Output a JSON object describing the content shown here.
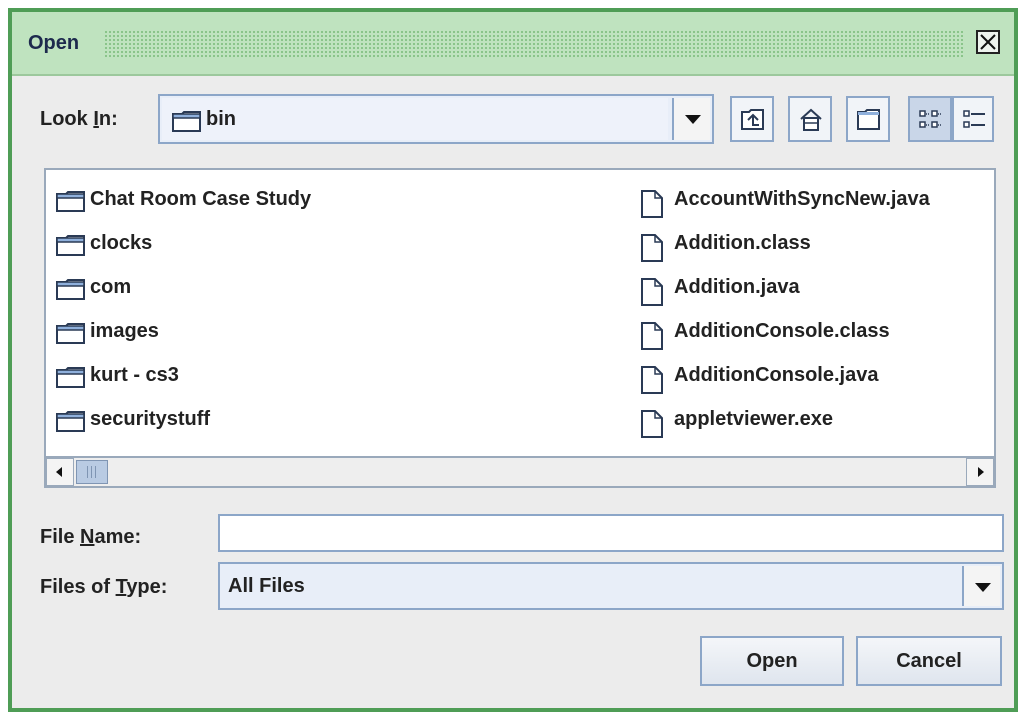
{
  "window": {
    "title": "Open"
  },
  "look_in": {
    "label_pre": "Look ",
    "label_mnemonic": "I",
    "label_post": "n:",
    "value": "bin",
    "folder_icon": "folder-icon"
  },
  "toolbar": {
    "buttons": [
      {
        "name": "up-one-level",
        "icon": "up-folder-icon"
      },
      {
        "name": "home",
        "icon": "home-icon"
      },
      {
        "name": "new-folder",
        "icon": "new-folder-icon"
      },
      {
        "name": "list-view",
        "icon": "list-view-icon",
        "selected": true
      },
      {
        "name": "details-view",
        "icon": "details-view-icon",
        "selected": false
      }
    ]
  },
  "files": {
    "column1": [
      {
        "name": "Chat Room Case Study",
        "type": "folder"
      },
      {
        "name": "clocks",
        "type": "folder"
      },
      {
        "name": "com",
        "type": "folder"
      },
      {
        "name": "images",
        "type": "folder"
      },
      {
        "name": "kurt - cs3",
        "type": "folder"
      },
      {
        "name": "securitystuff",
        "type": "folder"
      }
    ],
    "column2": [
      {
        "name": "AccountWithSyncNew.java",
        "type": "file"
      },
      {
        "name": "Addition.class",
        "type": "file"
      },
      {
        "name": "Addition.java",
        "type": "file"
      },
      {
        "name": "AdditionConsole.class",
        "type": "file"
      },
      {
        "name": "AdditionConsole.java",
        "type": "file"
      },
      {
        "name": "appletviewer.exe",
        "type": "file"
      }
    ]
  },
  "file_name": {
    "label_pre": "File ",
    "label_mnemonic": "N",
    "label_post": "ame:",
    "value": ""
  },
  "files_of_type": {
    "label_pre": "Files of ",
    "label_mnemonic": "T",
    "label_post": "ype:",
    "value": "All Files"
  },
  "buttons": {
    "open": "Open",
    "cancel": "Cancel"
  },
  "colors": {
    "title_bar": "#bfe3bf",
    "window_border": "#4f9d56",
    "control_border": "#8ca6c8"
  }
}
